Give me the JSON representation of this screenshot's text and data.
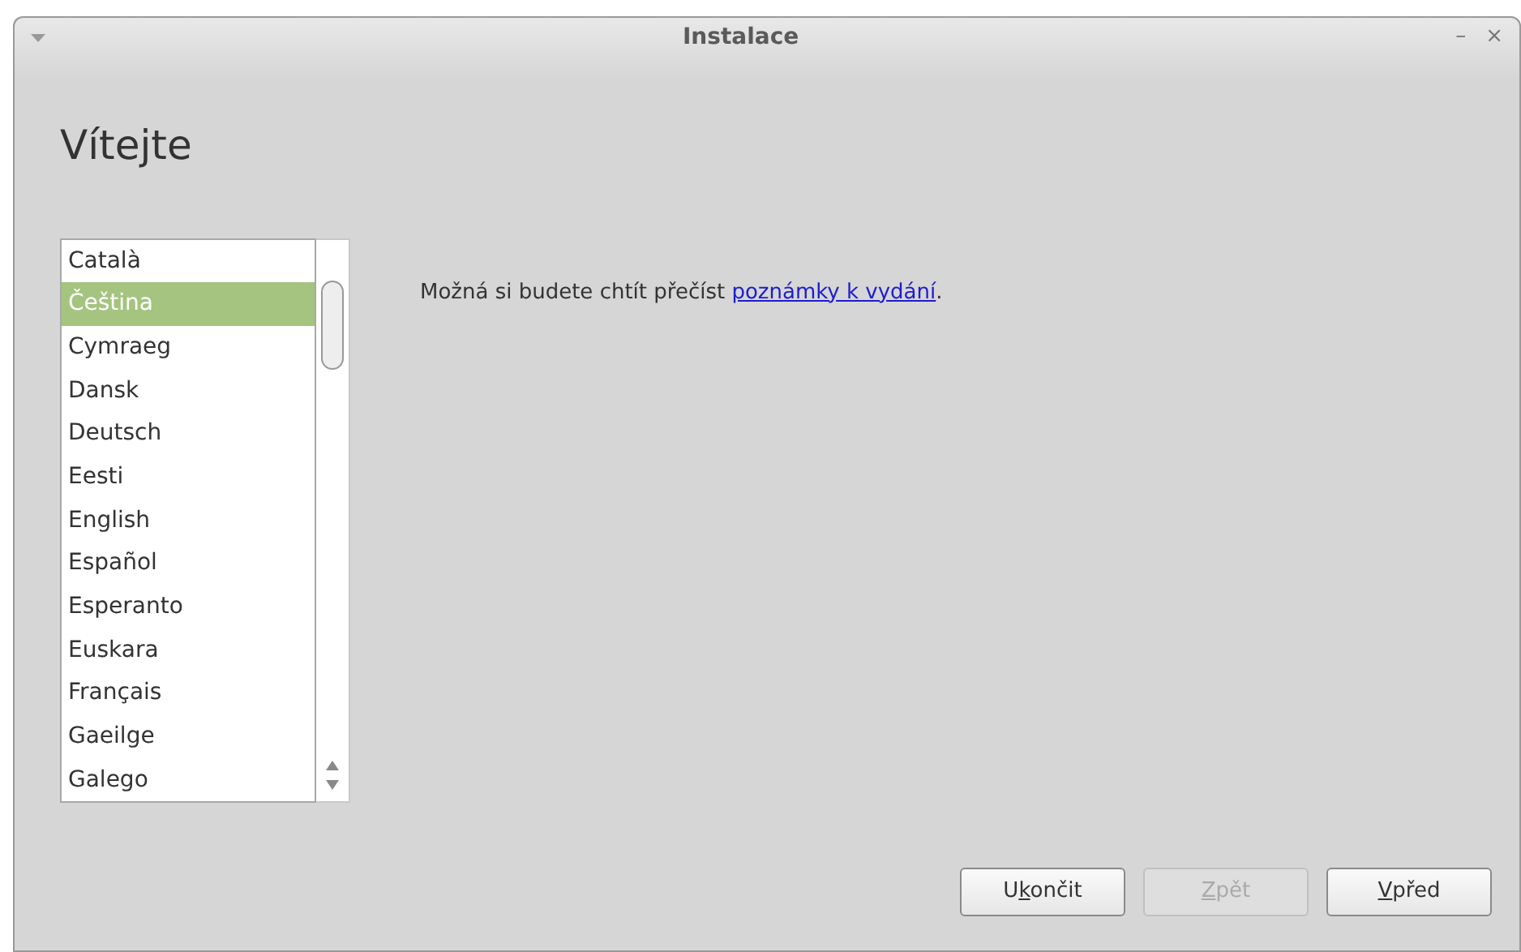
{
  "window": {
    "title": "Instalace",
    "controls": [
      "–",
      "×"
    ]
  },
  "heading": "Vítejte",
  "languages": [
    {
      "label": "Català",
      "selected": false
    },
    {
      "label": "Čeština",
      "selected": true
    },
    {
      "label": "Cymraeg",
      "selected": false
    },
    {
      "label": "Dansk",
      "selected": false
    },
    {
      "label": "Deutsch",
      "selected": false
    },
    {
      "label": "Eesti",
      "selected": false
    },
    {
      "label": "English",
      "selected": false
    },
    {
      "label": "Español",
      "selected": false
    },
    {
      "label": "Esperanto",
      "selected": false
    },
    {
      "label": "Euskara",
      "selected": false
    },
    {
      "label": "Français",
      "selected": false
    },
    {
      "label": "Gaeilge",
      "selected": false
    },
    {
      "label": "Galego",
      "selected": false
    }
  ],
  "message": {
    "text": "Možná si budete chtít přečíst ",
    "link": "poznámky k vydání",
    "end": "."
  },
  "buttons": [
    {
      "before": "U",
      "mnemonic": "k",
      "after": "ončit",
      "disabled": false
    },
    {
      "mnemonic": "Z",
      "after": "pět",
      "disabled": true
    },
    {
      "mnemonic": "V",
      "after": "před",
      "disabled": false
    }
  ]
}
